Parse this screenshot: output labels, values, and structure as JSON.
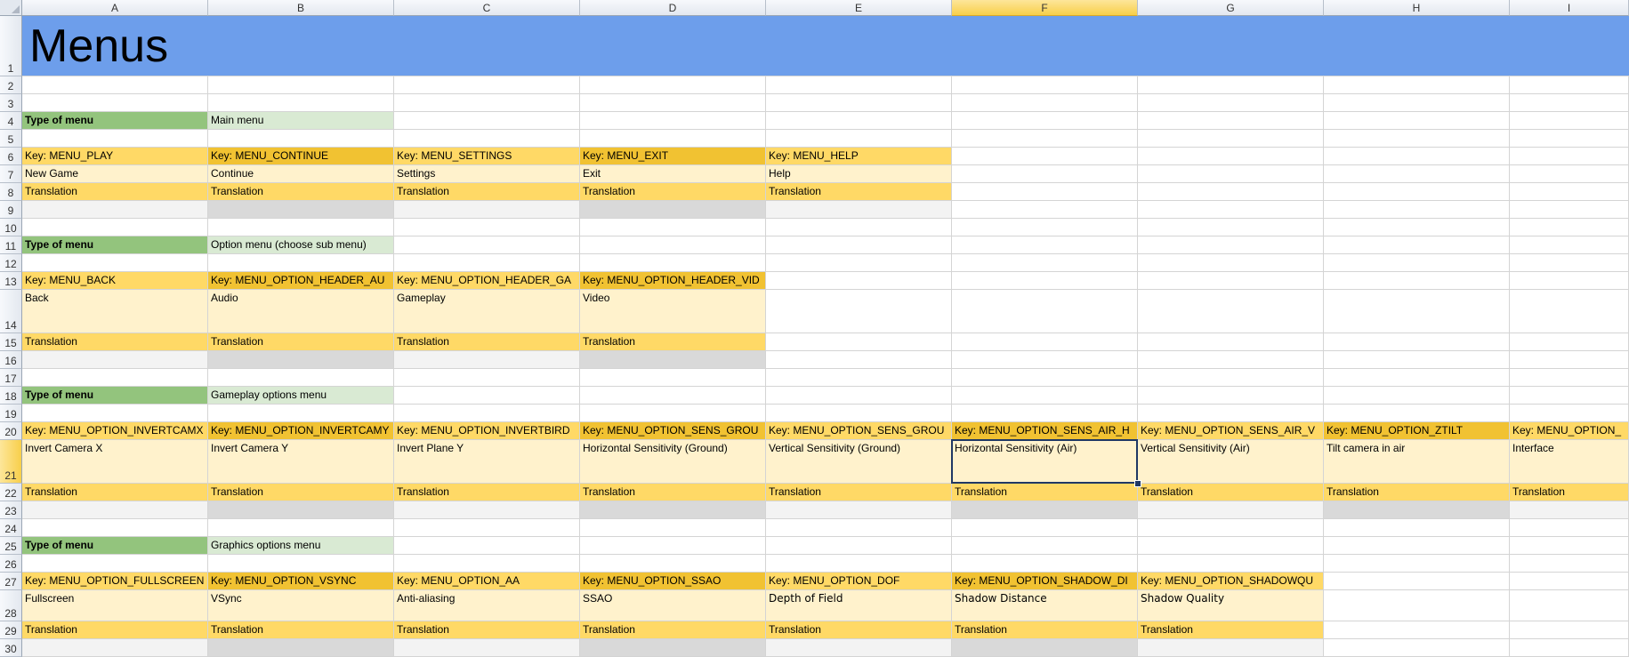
{
  "sheet": {
    "title": "Menus",
    "selected_cell": "F21",
    "columns": [
      "A",
      "B",
      "C",
      "D",
      "E",
      "F",
      "G",
      "H",
      "I"
    ],
    "rows": [
      {
        "n": "1"
      },
      {
        "n": "2"
      },
      {
        "n": "3"
      },
      {
        "n": "4",
        "cells": [
          {
            "c": 0,
            "t": "Type of menu",
            "s": "green"
          },
          {
            "c": 1,
            "t": "Main menu",
            "s": "lgreen"
          }
        ]
      },
      {
        "n": "5"
      },
      {
        "n": "6",
        "cells": [
          {
            "c": 0,
            "t": "Key: MENU_PLAY",
            "s": "key1"
          },
          {
            "c": 1,
            "t": "Key: MENU_CONTINUE",
            "s": "key2"
          },
          {
            "c": 2,
            "t": "Key: MENU_SETTINGS",
            "s": "key1"
          },
          {
            "c": 3,
            "t": "Key: MENU_EXIT",
            "s": "key2"
          },
          {
            "c": 4,
            "t": "Key: MENU_HELP",
            "s": "key1"
          }
        ]
      },
      {
        "n": "7",
        "cells": [
          {
            "c": 0,
            "t": "New Game",
            "s": "lt"
          },
          {
            "c": 1,
            "t": "Continue",
            "s": "lt"
          },
          {
            "c": 2,
            "t": "Settings",
            "s": "lt"
          },
          {
            "c": 3,
            "t": "Exit",
            "s": "lt"
          },
          {
            "c": 4,
            "t": "Help",
            "s": "lt"
          }
        ]
      },
      {
        "n": "8",
        "cells": [
          {
            "c": 0,
            "t": "Translation",
            "s": "key1"
          },
          {
            "c": 1,
            "t": "Translation",
            "s": "key1"
          },
          {
            "c": 2,
            "t": "Translation",
            "s": "key1"
          },
          {
            "c": 3,
            "t": "Translation",
            "s": "key1"
          },
          {
            "c": 4,
            "t": "Translation",
            "s": "key1"
          }
        ]
      },
      {
        "n": "9",
        "cells": [
          {
            "c": 0,
            "t": "",
            "s": "gray1"
          },
          {
            "c": 1,
            "t": "",
            "s": "gray2"
          },
          {
            "c": 2,
            "t": "",
            "s": "gray1"
          },
          {
            "c": 3,
            "t": "",
            "s": "gray2"
          },
          {
            "c": 4,
            "t": "",
            "s": "gray1"
          }
        ]
      },
      {
        "n": "10"
      },
      {
        "n": "11",
        "cells": [
          {
            "c": 0,
            "t": "Type of menu",
            "s": "green"
          },
          {
            "c": 1,
            "t": "Option menu (choose sub menu)",
            "s": "lgreen"
          }
        ]
      },
      {
        "n": "12"
      },
      {
        "n": "13",
        "cells": [
          {
            "c": 0,
            "t": "Key:  MENU_BACK",
            "s": "key1"
          },
          {
            "c": 1,
            "t": "Key: MENU_OPTION_HEADER_AUDIO",
            "s": "key2"
          },
          {
            "c": 2,
            "t": "Key: MENU_OPTION_HEADER_GAMEPLAY",
            "s": "key1"
          },
          {
            "c": 3,
            "t": "Key: MENU_OPTION_HEADER_VIDEO",
            "s": "key2"
          }
        ]
      },
      {
        "n": "14",
        "cells": [
          {
            "c": 0,
            "t": "Back",
            "s": "lt"
          },
          {
            "c": 1,
            "t": "Audio",
            "s": "lt"
          },
          {
            "c": 2,
            "t": "Gameplay",
            "s": "lt"
          },
          {
            "c": 3,
            "t": "Video",
            "s": "lt"
          }
        ]
      },
      {
        "n": "15",
        "cells": [
          {
            "c": 0,
            "t": "Translation",
            "s": "key1"
          },
          {
            "c": 1,
            "t": "Translation",
            "s": "key1"
          },
          {
            "c": 2,
            "t": "Translation",
            "s": "key1"
          },
          {
            "c": 3,
            "t": "Translation",
            "s": "key1"
          }
        ]
      },
      {
        "n": "16",
        "cells": [
          {
            "c": 0,
            "t": "",
            "s": "gray1"
          },
          {
            "c": 1,
            "t": "",
            "s": "gray2"
          },
          {
            "c": 2,
            "t": "",
            "s": "gray1"
          },
          {
            "c": 3,
            "t": "",
            "s": "gray2"
          }
        ]
      },
      {
        "n": "17"
      },
      {
        "n": "18",
        "cells": [
          {
            "c": 0,
            "t": "Type of menu",
            "s": "green"
          },
          {
            "c": 1,
            "t": "Gameplay options menu",
            "s": "lgreen"
          }
        ]
      },
      {
        "n": "19"
      },
      {
        "n": "20",
        "cells": [
          {
            "c": 0,
            "t": "Key: MENU_OPTION_INVERTCAMX",
            "s": "key1"
          },
          {
            "c": 1,
            "t": "Key: MENU_OPTION_INVERTCAMY",
            "s": "key2"
          },
          {
            "c": 2,
            "t": "Key: MENU_OPTION_INVERTBIRDY",
            "s": "key1"
          },
          {
            "c": 3,
            "t": "Key: MENU_OPTION_SENS_GROUND_HORI",
            "s": "key2"
          },
          {
            "c": 4,
            "t": "Key: MENU_OPTION_SENS_GROUND_VERT",
            "s": "key1"
          },
          {
            "c": 5,
            "t": "Key: MENU_OPTION_SENS_AIR_HORI",
            "s": "key2"
          },
          {
            "c": 6,
            "t": "Key: MENU_OPTION_SENS_AIR_VERT",
            "s": "key1"
          },
          {
            "c": 7,
            "t": "Key: MENU_OPTION_ZTILT",
            "s": "key2"
          },
          {
            "c": 8,
            "t": "Key: MENU_OPTION_SUBHEADER_INTERFACE",
            "s": "key1"
          }
        ]
      },
      {
        "n": "21",
        "cells": [
          {
            "c": 0,
            "t": "Invert Camera X",
            "s": "lt"
          },
          {
            "c": 1,
            "t": "Invert Camera Y",
            "s": "lt"
          },
          {
            "c": 2,
            "t": "Invert Plane Y",
            "s": "lt"
          },
          {
            "c": 3,
            "t": "Horizontal Sensitivity (Ground)",
            "s": "lt"
          },
          {
            "c": 4,
            "t": "Vertical Sensitivity (Ground)",
            "s": "lt"
          },
          {
            "c": 5,
            "t": "Horizontal Sensitivity (Air)",
            "s": "lt"
          },
          {
            "c": 6,
            "t": "Vertical Sensitivity (Air)",
            "s": "lt"
          },
          {
            "c": 7,
            "t": "Tilt camera in air",
            "s": "lt"
          },
          {
            "c": 8,
            "t": "Interface",
            "s": "lt"
          }
        ]
      },
      {
        "n": "22",
        "cells": [
          {
            "c": 0,
            "t": "Translation",
            "s": "key1"
          },
          {
            "c": 1,
            "t": "Translation",
            "s": "key1"
          },
          {
            "c": 2,
            "t": "Translation",
            "s": "key1"
          },
          {
            "c": 3,
            "t": "Translation",
            "s": "key1"
          },
          {
            "c": 4,
            "t": "Translation",
            "s": "key1"
          },
          {
            "c": 5,
            "t": "Translation",
            "s": "key1"
          },
          {
            "c": 6,
            "t": "Translation",
            "s": "key1"
          },
          {
            "c": 7,
            "t": "Translation",
            "s": "key1"
          },
          {
            "c": 8,
            "t": "Translation",
            "s": "key1"
          }
        ]
      },
      {
        "n": "23",
        "cells": [
          {
            "c": 0,
            "t": "",
            "s": "gray1"
          },
          {
            "c": 1,
            "t": "",
            "s": "gray2"
          },
          {
            "c": 2,
            "t": "",
            "s": "gray1"
          },
          {
            "c": 3,
            "t": "",
            "s": "gray2"
          },
          {
            "c": 4,
            "t": "",
            "s": "gray1"
          },
          {
            "c": 5,
            "t": "",
            "s": "gray2"
          },
          {
            "c": 6,
            "t": "",
            "s": "gray1"
          },
          {
            "c": 7,
            "t": "",
            "s": "gray2"
          },
          {
            "c": 8,
            "t": "",
            "s": "gray1"
          }
        ]
      },
      {
        "n": "24"
      },
      {
        "n": "25",
        "cells": [
          {
            "c": 0,
            "t": "Type of menu",
            "s": "green"
          },
          {
            "c": 1,
            "t": "Graphics options menu",
            "s": "lgreen"
          }
        ]
      },
      {
        "n": "26"
      },
      {
        "n": "27",
        "cells": [
          {
            "c": 0,
            "t": "Key: MENU_OPTION_FULLSCREEN",
            "s": "key1"
          },
          {
            "c": 1,
            "t": "Key: MENU_OPTION_VSYNC",
            "s": "key2"
          },
          {
            "c": 2,
            "t": "Key: MENU_OPTION_AA",
            "s": "key1"
          },
          {
            "c": 3,
            "t": "Key: MENU_OPTION_SSAO",
            "s": "key2"
          },
          {
            "c": 4,
            "t": "Key: MENU_OPTION_DOF",
            "s": "key1"
          },
          {
            "c": 5,
            "t": "Key: MENU_OPTION_SHADOW_DIST",
            "s": "key2"
          },
          {
            "c": 6,
            "t": "Key: MENU_OPTION_SHADOWQUALITY",
            "s": "key1"
          }
        ]
      },
      {
        "n": "28",
        "cells": [
          {
            "c": 0,
            "t": "Fullscreen",
            "s": "lt"
          },
          {
            "c": 1,
            "t": "VSync",
            "s": "lt"
          },
          {
            "c": 2,
            "t": "Anti-aliasing",
            "s": "lt"
          },
          {
            "c": 3,
            "t": "SSAO",
            "s": "lt"
          },
          {
            "c": 4,
            "t": "Depth of Field",
            "s": "lt",
            "font": "cal"
          },
          {
            "c": 5,
            "t": "Shadow Distance",
            "s": "lt",
            "font": "cal"
          },
          {
            "c": 6,
            "t": "Shadow Quality",
            "s": "lt",
            "font": "cal"
          }
        ]
      },
      {
        "n": "29",
        "cells": [
          {
            "c": 0,
            "t": "Translation",
            "s": "key1"
          },
          {
            "c": 1,
            "t": "Translation",
            "s": "key1"
          },
          {
            "c": 2,
            "t": "Translation",
            "s": "key1"
          },
          {
            "c": 3,
            "t": "Translation",
            "s": "key1"
          },
          {
            "c": 4,
            "t": "Translation",
            "s": "key1"
          },
          {
            "c": 5,
            "t": "Translation",
            "s": "key1"
          },
          {
            "c": 6,
            "t": "Translation",
            "s": "key1"
          }
        ]
      },
      {
        "n": "30",
        "cells": [
          {
            "c": 0,
            "t": "",
            "s": "gray1"
          },
          {
            "c": 1,
            "t": "",
            "s": "gray2"
          },
          {
            "c": 2,
            "t": "",
            "s": "gray1"
          },
          {
            "c": 3,
            "t": "",
            "s": "gray2"
          },
          {
            "c": 4,
            "t": "",
            "s": "gray1"
          },
          {
            "c": 5,
            "t": "",
            "s": "gray2"
          },
          {
            "c": 6,
            "t": "",
            "s": "gray1"
          }
        ]
      }
    ]
  },
  "colors": {
    "title_band": "#6d9eeb",
    "type_label": "#93c47d",
    "type_value": "#d9ead3",
    "key_light": "#ffd966",
    "key_dark": "#f1c232",
    "text_row": "#fff2cc",
    "separator_light": "#f3f3f3",
    "separator_dark": "#d9d9d9",
    "selection": "#1f3864"
  }
}
